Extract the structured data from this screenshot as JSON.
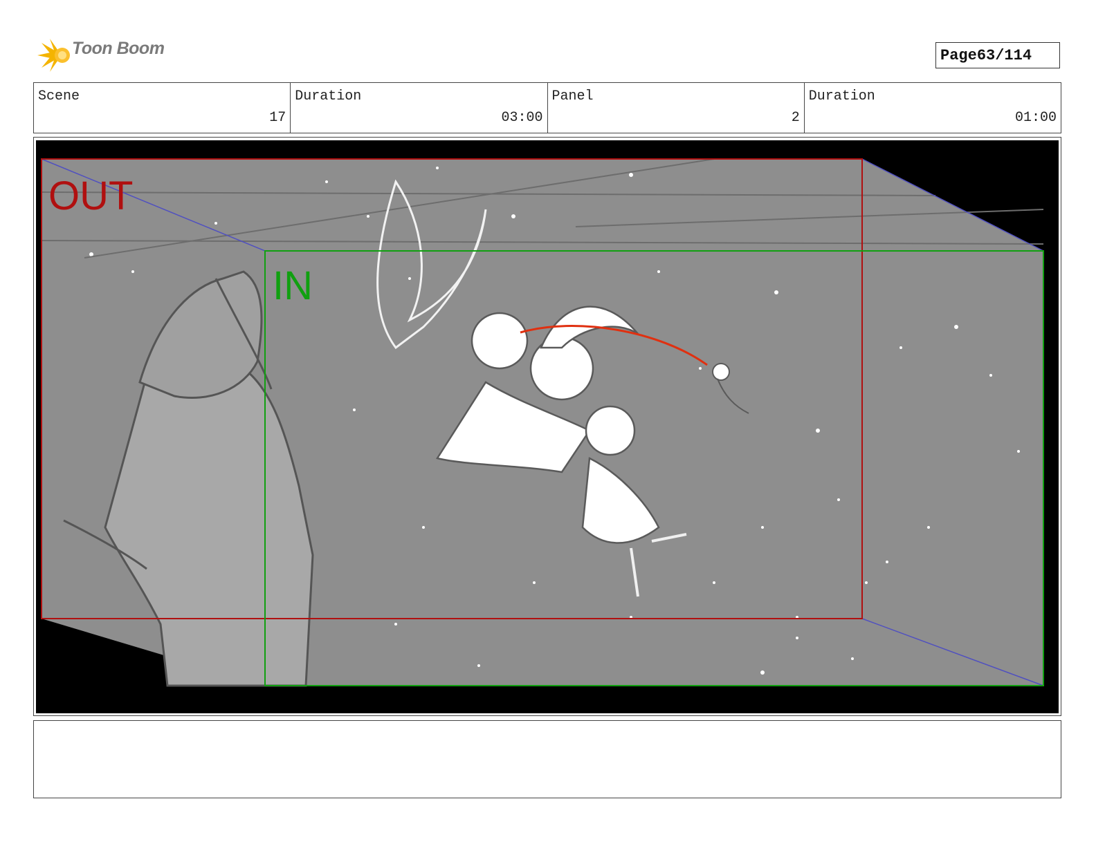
{
  "header": {
    "logo_text": "Toon Boom",
    "page_label": "Page",
    "page_value": "63/114"
  },
  "info": {
    "scene_label": "Scene",
    "scene_value": "17",
    "scene_duration_label": "Duration",
    "scene_duration_value": "03:00",
    "panel_label": "Panel",
    "panel_value": "2",
    "panel_duration_label": "Duration",
    "panel_duration_value": "01:00"
  },
  "panel": {
    "out_label": "OUT",
    "in_label": "IN",
    "out_color": "#b01010",
    "in_color": "#10a010",
    "background_color": "#8e8e8e"
  },
  "notes": {
    "text": ""
  }
}
